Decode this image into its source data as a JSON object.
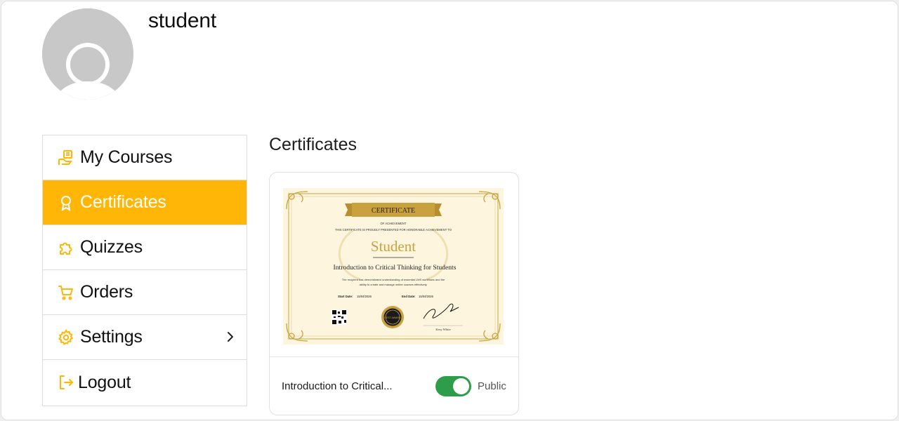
{
  "profile": {
    "username": "student"
  },
  "sidebar": {
    "items": [
      {
        "label": "My Courses",
        "icon": "courses-icon",
        "active": false
      },
      {
        "label": "Certificates",
        "icon": "award-icon",
        "active": true
      },
      {
        "label": "Quizzes",
        "icon": "puzzle-icon",
        "active": false
      },
      {
        "label": "Orders",
        "icon": "cart-icon",
        "active": false
      },
      {
        "label": "Settings",
        "icon": "gear-icon",
        "active": false,
        "has_submenu": true
      },
      {
        "label": "Logout",
        "icon": "logout-icon",
        "active": false
      }
    ]
  },
  "main": {
    "title": "Certificates",
    "certificates": [
      {
        "course_name": "Introduction to Critical...",
        "visibility_label": "Public",
        "is_public": true,
        "preview": {
          "banner": "CERTIFICATE",
          "subtitle": "OF ACHIEVEMENT",
          "presented_line": "THIS CERTIFICATE IS PROUDLY PRESENTED FOR HONORABLE ACHIEVEMENT TO",
          "recipient": "Student",
          "course": "Introduction to Critical Thinking for Students",
          "description_line1": "The recipient has demonstrated understanding of essential LMS workflows and the",
          "description_line2": "ability to create and manage online courses effectively.",
          "start_date_label": "Start Date:",
          "start_date": "15/04/2026",
          "end_date_label": "End Date:",
          "end_date": "15/04/2026",
          "seal_text": "BEST AWARD",
          "signer": "Kesy White"
        }
      }
    ]
  },
  "colors": {
    "accent": "#ffb606",
    "toggle_on": "#2e9d4a",
    "cert_gold": "#c9a23f",
    "cert_bg": "#fdf5dd"
  }
}
